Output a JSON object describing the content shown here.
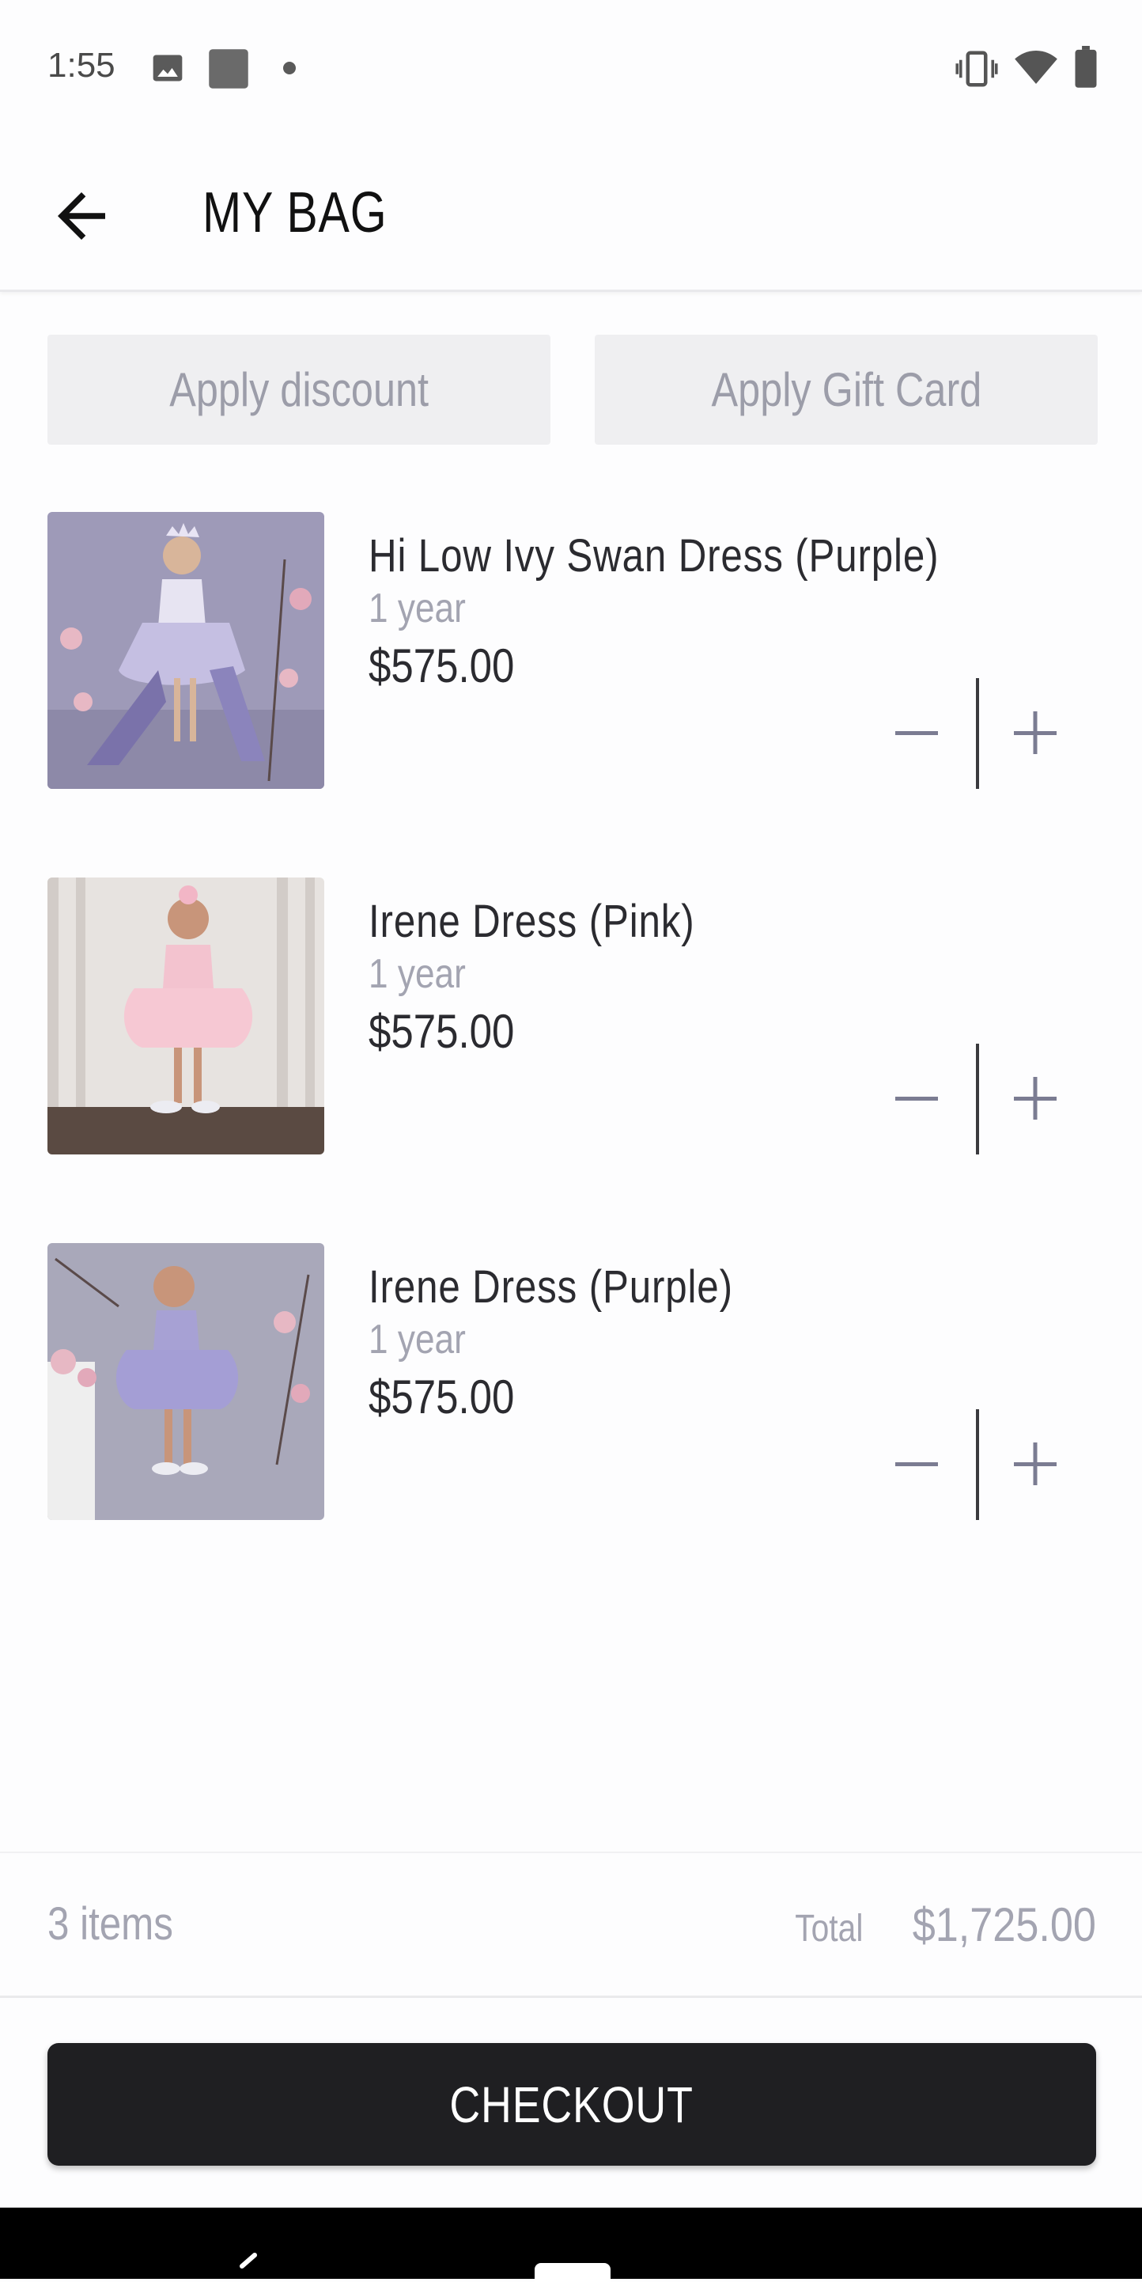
{
  "status_bar": {
    "time": "1:55",
    "icons": [
      "image-icon",
      "square-icon",
      "dot-icon",
      "vibrate-icon",
      "wifi-icon",
      "battery-icon"
    ]
  },
  "header": {
    "title": "MY BAG",
    "back_icon": "arrow-back-icon"
  },
  "actions": {
    "discount_label": "Apply discount",
    "gift_card_label": "Apply Gift Card"
  },
  "cart": {
    "items": [
      {
        "name": "Hi Low Ivy Swan Dress (Purple)",
        "size": "1 year",
        "price": "$575.00"
      },
      {
        "name": "Irene Dress (Pink)",
        "size": "1 year",
        "price": "$575.00"
      },
      {
        "name": "Irene Dress (Purple)",
        "size": "1 year",
        "price": "$575.00"
      }
    ]
  },
  "summary": {
    "item_count": "3 items",
    "total_label": "Total",
    "total_value": "$1,725.00"
  },
  "checkout": {
    "label": "CHECKOUT"
  },
  "colors": {
    "primary_button": "#1f1f22",
    "muted_text": "#a3a4b1",
    "pill_bg": "#efeff1"
  }
}
